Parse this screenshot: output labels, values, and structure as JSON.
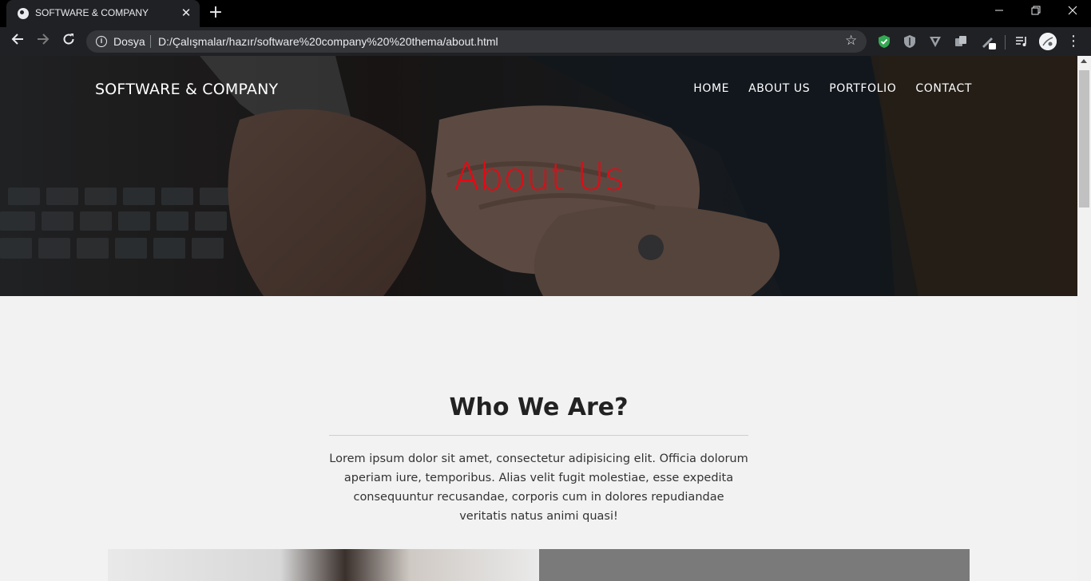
{
  "browser": {
    "tab_title": "SOFTWARE & COMPANY",
    "tab_close_glyph": "✕",
    "new_tab_glyph": "+",
    "url_scheme_label": "Dosya",
    "url": "D:/Çalışmalar/hazır/software%20company%20%20thema/about.html",
    "icons": [
      "globe-icon",
      "close-icon",
      "plus-icon",
      "back-icon",
      "forward-icon",
      "reload-icon",
      "info-icon",
      "star-icon",
      "shield-check-icon",
      "shield-icon",
      "v-icon",
      "copy-icon",
      "pen-icon",
      "queue-icon",
      "avatar",
      "more-icon",
      "minimize-icon",
      "restore-icon",
      "window-close-icon"
    ]
  },
  "site": {
    "brand": "SOFTWARE & COMPANY",
    "nav": [
      {
        "label": "HOME"
      },
      {
        "label": "ABOUT US"
      },
      {
        "label": "PORTFOLIO"
      },
      {
        "label": "CONTACT"
      }
    ],
    "hero_title": "About Us",
    "section": {
      "title": "Who We Are?",
      "text": "Lorem ipsum dolor sit amet, consectetur adipisicing elit. Officia dolorum aperiam iure, temporibus. Alias velit fugit molestiae, esse expedita consequuntur recusandae, corporis cum in dolores repudiandae veritatis natus animi quasi!"
    }
  },
  "colors": {
    "hero_title": "#e50914",
    "page_background": "#f2f2f2",
    "browser_dark": "#202124"
  }
}
